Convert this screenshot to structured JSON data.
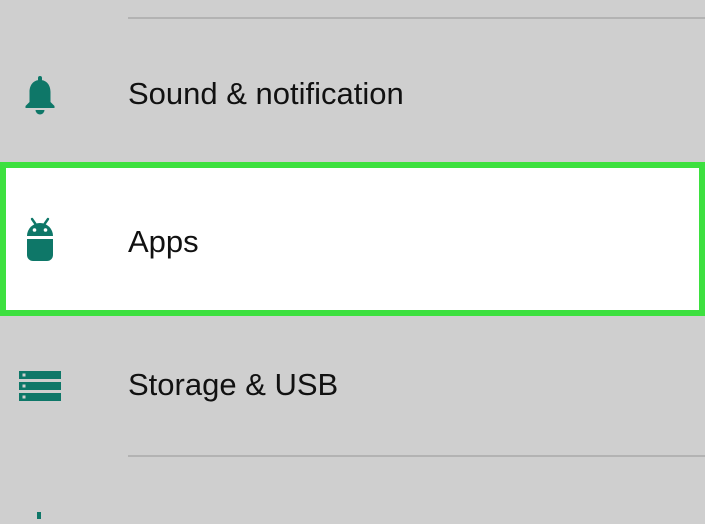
{
  "settings": {
    "items": [
      {
        "label": "Sound & notification",
        "icon": "bell-icon"
      },
      {
        "label": "Apps",
        "icon": "android-icon",
        "highlighted": true
      },
      {
        "label": "Storage & USB",
        "icon": "storage-icon"
      }
    ]
  },
  "colors": {
    "background": "#cfcfcf",
    "selected_background": "#ffffff",
    "highlight_border": "#3de03f",
    "icon": "#0e7768",
    "divider": "#b3b3b3"
  }
}
